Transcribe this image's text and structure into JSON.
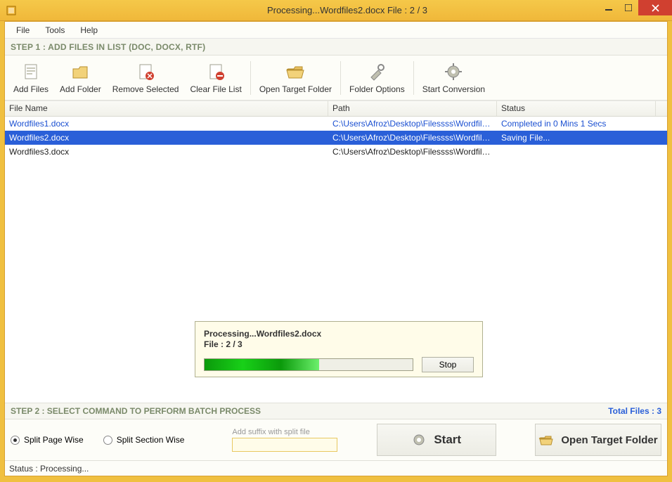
{
  "window": {
    "title": "Processing...Wordfiles2.docx File : 2 / 3"
  },
  "menu": {
    "file": "File",
    "tools": "Tools",
    "help": "Help"
  },
  "step1_label": "STEP 1 : ADD FILES IN LIST (DOC, DOCX, RTF)",
  "toolbar": {
    "add_files": "Add Files",
    "add_folder": "Add Folder",
    "remove_selected": "Remove Selected",
    "clear_list": "Clear File List",
    "open_target": "Open Target Folder",
    "folder_opts": "Folder Options",
    "start_conv": "Start Conversion"
  },
  "table": {
    "headers": {
      "file": "File Name",
      "path": "Path",
      "status": "Status"
    },
    "rows": [
      {
        "state": "done",
        "file": "Wordfiles1.docx",
        "path": "C:\\Users\\Afroz\\Desktop\\Filessss\\Wordfiles...",
        "status": "Completed in 0 Mins 1 Secs"
      },
      {
        "state": "sel",
        "file": "Wordfiles2.docx",
        "path": "C:\\Users\\Afroz\\Desktop\\Filessss\\Wordfiles...",
        "status": "Saving File..."
      },
      {
        "state": "pending",
        "file": "Wordfiles3.docx",
        "path": "C:\\Users\\Afroz\\Desktop\\Filessss\\Wordfiles...",
        "status": ""
      }
    ]
  },
  "step2_label": "STEP 2 : SELECT COMMAND TO PERFORM BATCH PROCESS",
  "total_files": "Total Files : 3",
  "options": {
    "split_page": "Split Page Wise",
    "split_section": "Split Section Wise",
    "suffix_label": "Add suffix with split file",
    "suffix_value": ""
  },
  "buttons": {
    "start": "Start",
    "open_target": "Open Target Folder"
  },
  "statusbar": "Status  :  Processing...",
  "dialog": {
    "line1": "Processing...Wordfiles2.docx",
    "line2": "File : 2 / 3",
    "stop": "Stop",
    "progress_pct": 55
  }
}
